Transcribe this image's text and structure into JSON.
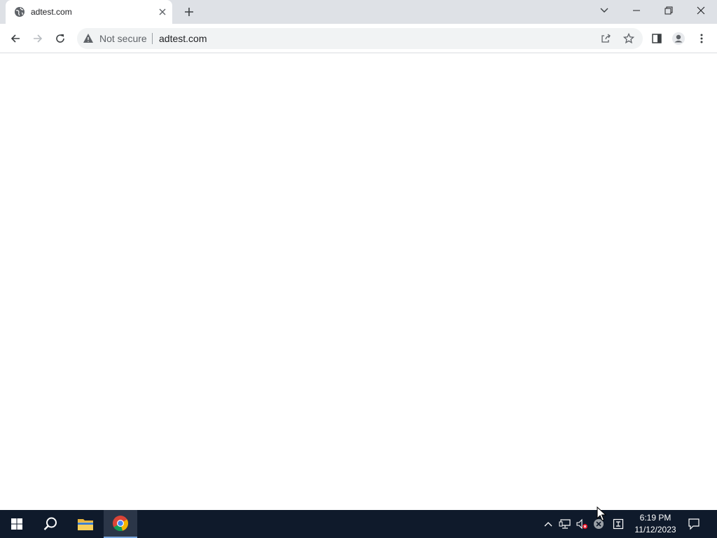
{
  "browser": {
    "tab": {
      "title": "adtest.com",
      "favicon": "globe-icon"
    },
    "new_tab_label": "+",
    "address_bar": {
      "security_label": "Not secure",
      "url": "adtest.com"
    }
  },
  "taskbar": {
    "clock": {
      "time": "6:19 PM",
      "date": "11/12/2023"
    }
  },
  "colors": {
    "tabstrip": "#dee1e6",
    "taskbar": "#0f1a2b",
    "omnibox": "#f1f3f4"
  }
}
